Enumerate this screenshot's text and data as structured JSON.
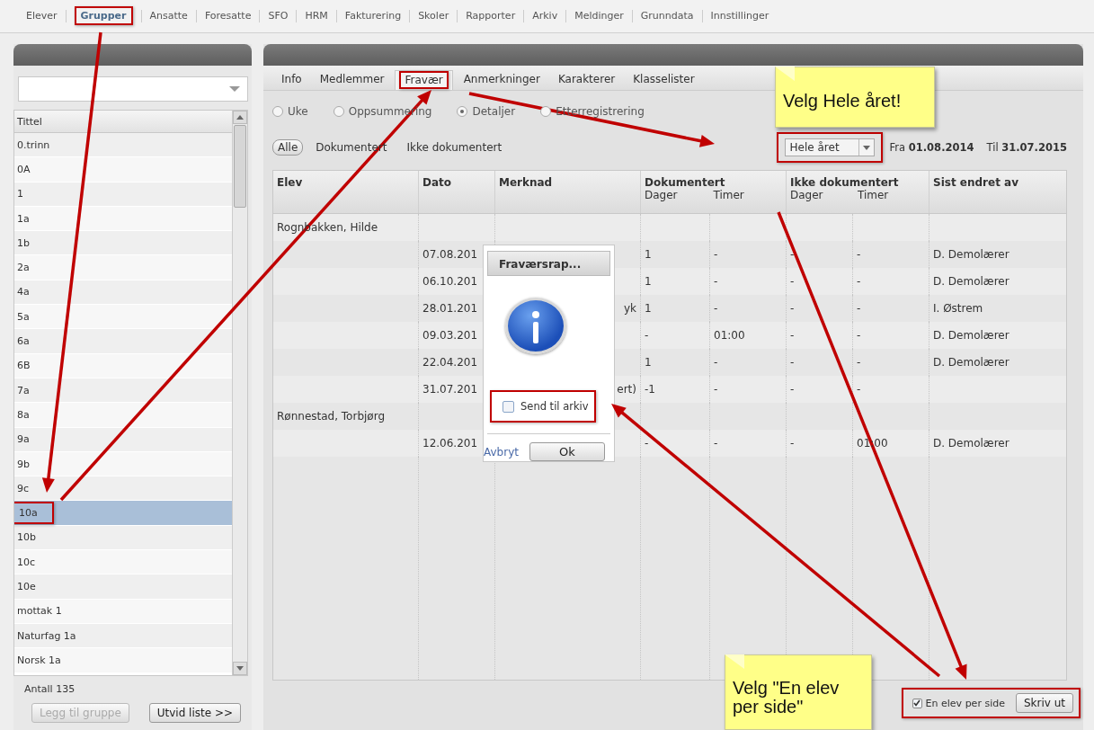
{
  "nav": [
    {
      "label": "Elever",
      "selected": false,
      "highlighted": false
    },
    {
      "label": "Grupper",
      "selected": true,
      "highlighted": true
    },
    {
      "label": "Ansatte",
      "selected": false,
      "highlighted": false
    },
    {
      "label": "Foresatte",
      "selected": false,
      "highlighted": false
    },
    {
      "label": "SFO",
      "selected": false,
      "highlighted": false
    },
    {
      "label": "HRM",
      "selected": false,
      "highlighted": false
    },
    {
      "label": "Fakturering",
      "selected": false,
      "highlighted": false
    },
    {
      "label": "Skoler",
      "selected": false,
      "highlighted": false
    },
    {
      "label": "Rapporter",
      "selected": false,
      "highlighted": false
    },
    {
      "label": "Arkiv",
      "selected": false,
      "highlighted": false
    },
    {
      "label": "Meldinger",
      "selected": false,
      "highlighted": false
    },
    {
      "label": "Grunndata",
      "selected": false,
      "highlighted": false
    },
    {
      "label": "Innstillinger",
      "selected": false,
      "highlighted": false
    }
  ],
  "groups": {
    "list_header": "Tittel",
    "items": [
      {
        "label": "0.trinn",
        "selected": false,
        "highlighted": false
      },
      {
        "label": "0A",
        "selected": false,
        "highlighted": false
      },
      {
        "label": "1",
        "selected": false,
        "highlighted": false
      },
      {
        "label": "1a",
        "selected": false,
        "highlighted": false
      },
      {
        "label": "1b",
        "selected": false,
        "highlighted": false
      },
      {
        "label": "2a",
        "selected": false,
        "highlighted": false
      },
      {
        "label": "4a",
        "selected": false,
        "highlighted": false
      },
      {
        "label": "5a",
        "selected": false,
        "highlighted": false
      },
      {
        "label": "6a",
        "selected": false,
        "highlighted": false
      },
      {
        "label": "6B",
        "selected": false,
        "highlighted": false
      },
      {
        "label": "7a",
        "selected": false,
        "highlighted": false
      },
      {
        "label": "8a",
        "selected": false,
        "highlighted": false
      },
      {
        "label": "9a",
        "selected": false,
        "highlighted": false
      },
      {
        "label": "9b",
        "selected": false,
        "highlighted": false
      },
      {
        "label": "9c",
        "selected": false,
        "highlighted": false
      },
      {
        "label": "10a",
        "selected": true,
        "highlighted": true
      },
      {
        "label": "10b",
        "selected": false,
        "highlighted": false
      },
      {
        "label": "10c",
        "selected": false,
        "highlighted": false
      },
      {
        "label": "10e",
        "selected": false,
        "highlighted": false
      },
      {
        "label": "mottak 1",
        "selected": false,
        "highlighted": false
      },
      {
        "label": "Naturfag 1a",
        "selected": false,
        "highlighted": false
      },
      {
        "label": "Norsk 1a",
        "selected": false,
        "highlighted": false
      }
    ],
    "count": "Antall 135",
    "buttons": [
      {
        "label": "Legg til gruppe",
        "disabled": true
      },
      {
        "label": "Utvid liste >>",
        "disabled": false
      }
    ]
  },
  "tabs": [
    {
      "label": "Info",
      "selected": false,
      "highlighted": false
    },
    {
      "label": "Medlemmer",
      "selected": false,
      "highlighted": false
    },
    {
      "label": "Fravær",
      "selected": true,
      "highlighted": true
    },
    {
      "label": "Anmerkninger",
      "selected": false,
      "highlighted": false
    },
    {
      "label": "Karakterer",
      "selected": false,
      "highlighted": false
    },
    {
      "label": "Klasselister",
      "selected": false,
      "highlighted": false
    }
  ],
  "views": [
    {
      "label": "Uke",
      "selected": false
    },
    {
      "label": "Oppsummering",
      "selected": false
    },
    {
      "label": "Detaljer",
      "selected": true
    },
    {
      "label": "Etterregistrering",
      "selected": false
    }
  ],
  "filters": [
    {
      "label": "Alle",
      "selected": true
    },
    {
      "label": "Dokumentert",
      "selected": false
    },
    {
      "label": "Ikke dokumentert",
      "selected": false
    }
  ],
  "period": {
    "value": "Hele året",
    "highlighted": true,
    "from": "Fra **01.08.2014**",
    "to": "Til **31.07.2015**"
  },
  "table": {
    "columns": [
      {
        "label": "Elev"
      },
      {
        "label": "Dato"
      },
      {
        "label": "Merknad"
      },
      {
        "label": "Dokumentert",
        "sub": [
          "Dager",
          "Timer"
        ]
      },
      {
        "label": "Ikke dokumentert",
        "sub": [
          "Dager",
          "Timer"
        ]
      },
      {
        "label": "Sist endret av"
      }
    ],
    "rows": [
      {
        "kind": "group",
        "name": "Rognbakken, Hilde"
      },
      {
        "kind": "entry",
        "cells": [
          "07.08.201",
          "",
          "1",
          "-",
          "-",
          "-",
          "D. Demolærer"
        ]
      },
      {
        "kind": "entry",
        "cells": [
          "06.10.201",
          "",
          "1",
          "-",
          "-",
          "-",
          "D. Demolærer"
        ]
      },
      {
        "kind": "entry",
        "cells": [
          "28.01.201",
          "yk",
          "1",
          "-",
          "-",
          "-",
          "I. Østrem"
        ]
      },
      {
        "kind": "entry",
        "cells": [
          "09.03.201",
          "",
          "-",
          "01:00",
          "-",
          "-",
          "D. Demolærer"
        ]
      },
      {
        "kind": "entry",
        "cells": [
          "22.04.201",
          "",
          "1",
          "-",
          "-",
          "-",
          "D. Demolærer"
        ]
      },
      {
        "kind": "entry",
        "cells": [
          "31.07.201",
          "ert)",
          "-1",
          "-",
          "-",
          "-",
          ""
        ]
      },
      {
        "kind": "group",
        "name": "Rønnestad, Torbjørg"
      },
      {
        "kind": "entry",
        "cells": [
          "12.06.201",
          "",
          "-",
          "-",
          "-",
          "01:00",
          "D. Demolærer"
        ]
      }
    ]
  },
  "dialog": {
    "title": "Fraværsrap...",
    "checkbox": {
      "label": "Send til arkiv",
      "checked": false,
      "highlighted": true
    },
    "cancel": "Avbryt",
    "ok": "Ok"
  },
  "print": {
    "highlighted": true,
    "checkbox": {
      "label": "En elev per side",
      "checked": true
    },
    "button": "Skriv ut"
  },
  "notes": [
    "Velg Hele året!",
    "Velg \"En elev\nper side\""
  ]
}
